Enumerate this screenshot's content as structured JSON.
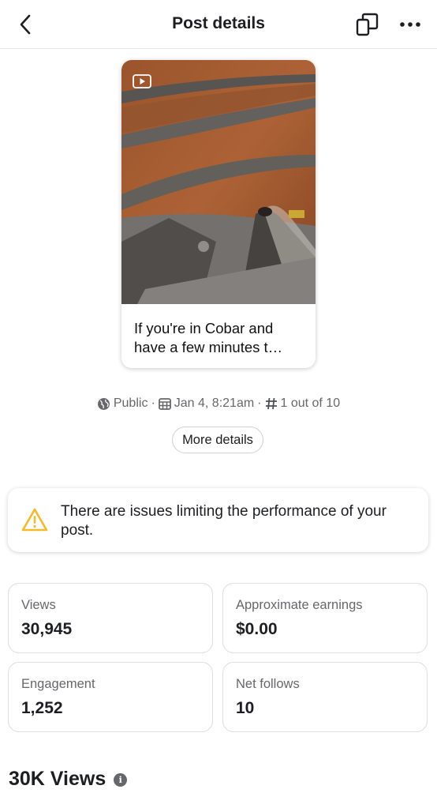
{
  "header": {
    "title": "Post details",
    "back_icon": "chevron-left-icon",
    "copy_icon": "copy-icon",
    "more_icon": "more-dots-icon"
  },
  "post": {
    "caption": "If you're in Cobar and have a few minutes t…",
    "media_type_icon": "video-play-icon"
  },
  "meta": {
    "visibility": "Public",
    "date": "Jan 4, 8:21am",
    "rank": "1 out of 10",
    "sep": "·"
  },
  "more_details_label": "More details",
  "warning": {
    "text": "There are issues limiting the performance of your post.",
    "color": "#f7b928"
  },
  "stats": [
    {
      "label": "Views",
      "value": "30,945"
    },
    {
      "label": "Approximate earnings",
      "value": "$0.00"
    },
    {
      "label": "Engagement",
      "value": "1,252"
    },
    {
      "label": "Net follows",
      "value": "10"
    }
  ],
  "section": {
    "title": "30K Views",
    "info_glyph": "i"
  }
}
